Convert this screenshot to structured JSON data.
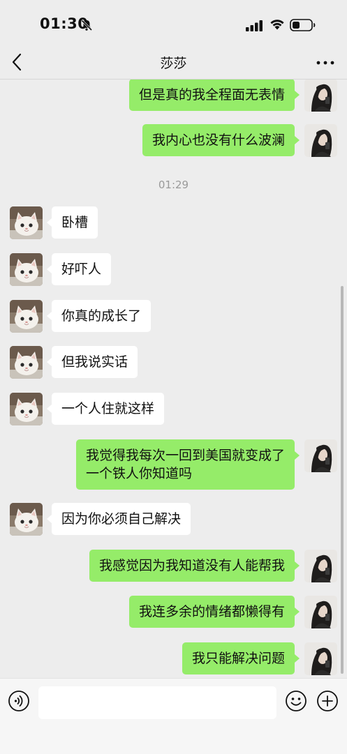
{
  "status_bar": {
    "time": "01:30"
  },
  "nav": {
    "title": "莎莎"
  },
  "chat": {
    "timestamp": "01:29",
    "messages": [
      {
        "side": "out",
        "text": "但是真的我全程面无表情"
      },
      {
        "side": "out",
        "text": "我内心也没有什么波澜"
      },
      {
        "side": "in",
        "text": "卧槽"
      },
      {
        "side": "in",
        "text": "好吓人"
      },
      {
        "side": "in",
        "text": "你真的成长了"
      },
      {
        "side": "in",
        "text": "但我说实话"
      },
      {
        "side": "in",
        "text": "一个人住就这样"
      },
      {
        "side": "out",
        "line1": "我觉得我每次一回到美国就变成了",
        "line2": "一个铁人你知道吗"
      },
      {
        "side": "in",
        "text": "因为你必须自己解决"
      },
      {
        "side": "out",
        "text": "我感觉因为我知道没有人能帮我"
      },
      {
        "side": "out",
        "text": "我连多余的情绪都懒得有"
      },
      {
        "side": "out",
        "text": "我只能解决问题"
      }
    ]
  },
  "input_bar": {
    "value": ""
  },
  "icons": {
    "back": "chevron-left-icon",
    "more": "more-dots-icon",
    "voice": "voice-icon",
    "emoji": "emoji-icon",
    "plus": "plus-circle-icon",
    "bell": "bell-slash-icon",
    "wifi": "wifi-icon",
    "battery": "battery-icon",
    "signal": "signal-icon"
  },
  "colors": {
    "background": "#ededed",
    "outgoing_bubble": "#95ec69",
    "incoming_bubble": "#ffffff",
    "timestamp": "#9a9a9a"
  }
}
